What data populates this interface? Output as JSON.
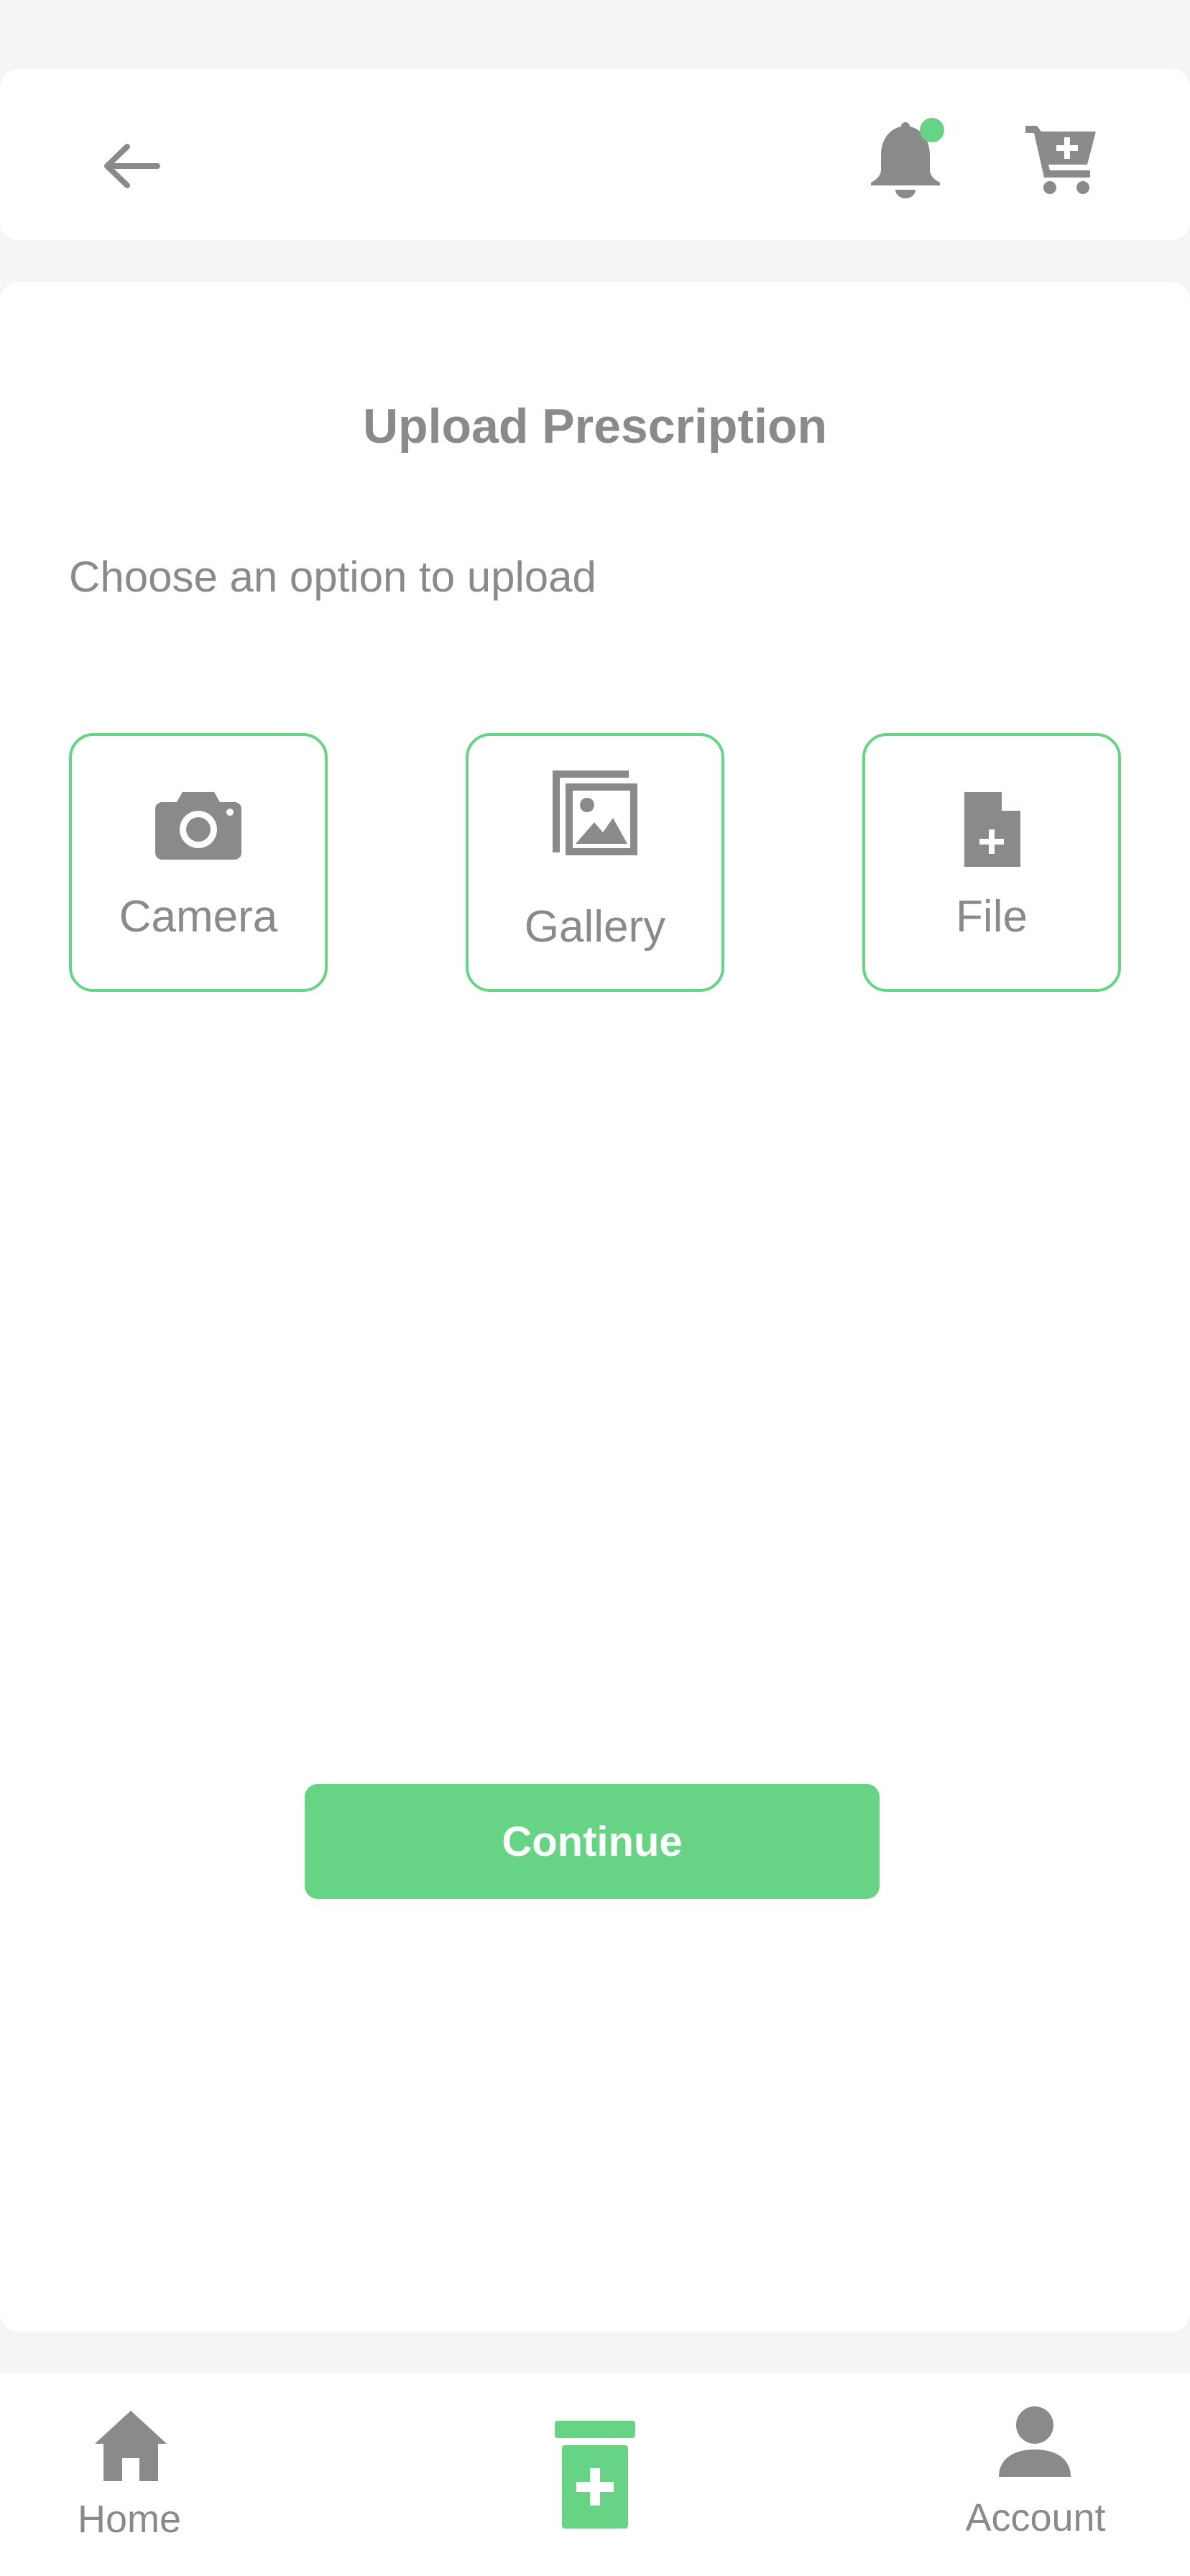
{
  "colors": {
    "accent": "#66d385",
    "icon_gray": "#8a8a8a",
    "background": "#f5f5f5",
    "surface": "#ffffff"
  },
  "header": {
    "back_icon": "arrow-left-icon",
    "notification_icon": "bell-icon",
    "notification_badge": true,
    "cart_icon": "cart-plus-icon"
  },
  "page": {
    "title": "Upload Prescription",
    "subtitle": "Choose an option to upload"
  },
  "options": [
    {
      "label": "Camera",
      "icon": "camera-icon"
    },
    {
      "label": "Gallery",
      "icon": "gallery-icon"
    },
    {
      "label": "File",
      "icon": "file-plus-icon"
    }
  ],
  "actions": {
    "continue_label": "Continue"
  },
  "bottom_nav": {
    "home": {
      "label": "Home",
      "icon": "home-icon"
    },
    "prescription": {
      "label": "",
      "icon": "medicine-bottle-icon",
      "active": true
    },
    "account": {
      "label": "Account",
      "icon": "user-icon"
    }
  }
}
